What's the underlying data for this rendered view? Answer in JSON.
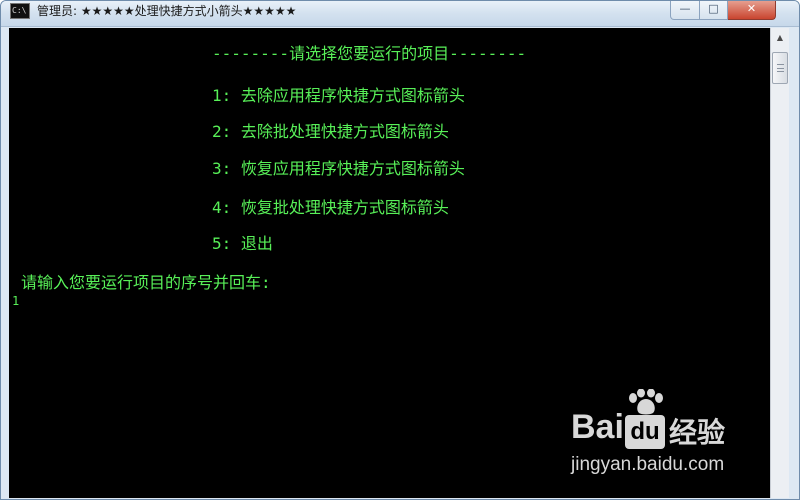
{
  "window": {
    "title": "管理员: ★★★★★处理快捷方式小箭头★★★★★",
    "icon": "console-icon",
    "icon_glyph": "C:\\",
    "controls": {
      "minimize_glyph": "—",
      "maximize_glyph": "□",
      "close_glyph": "✕"
    }
  },
  "console": {
    "text_color": "#58f058",
    "background_color": "#000000",
    "banner": "--------请选择您要运行的项目--------",
    "menu": [
      "1: 去除应用程序快捷方式图标箭头",
      "2: 去除批处理快捷方式图标箭头",
      "3: 恢复应用程序快捷方式图标箭头",
      "4: 恢复批处理快捷方式图标箭头",
      "5: 退出"
    ],
    "prompt": "请输入您要运行项目的序号并回车:",
    "input_value": "1"
  },
  "scrollbar": {
    "up_arrow_glyph": "▲"
  },
  "watermark": {
    "brand": "Bai",
    "brand_du": "du",
    "brand_suffix": "经验",
    "url": "jingyan.baidu.com",
    "color": "#d8d8d8"
  }
}
